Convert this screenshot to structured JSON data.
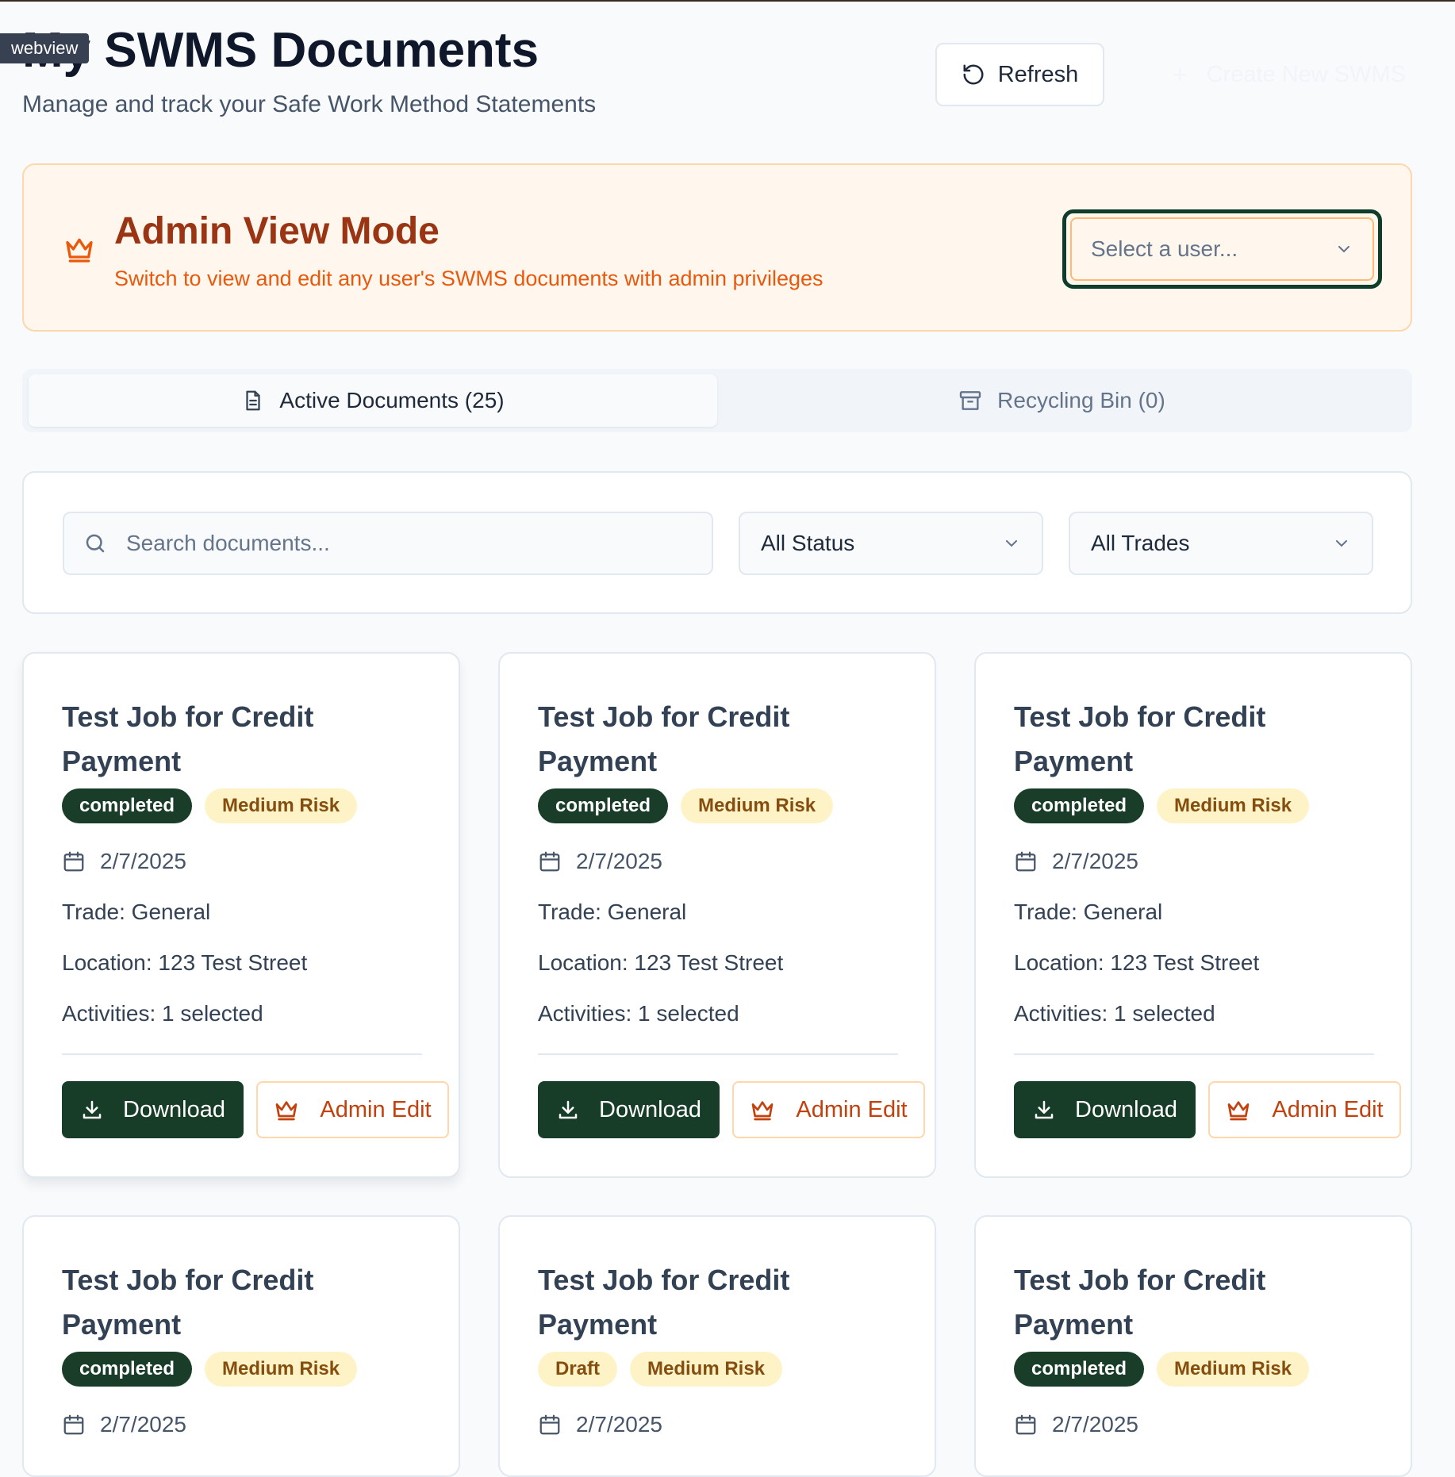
{
  "webview_tag": "webview",
  "header": {
    "title": "My SWMS Documents",
    "subtitle": "Manage and track your Safe Work Method Statements",
    "refresh_label": "Refresh",
    "create_label": "Create New SWMS"
  },
  "admin": {
    "title": "Admin View Mode",
    "description": "Switch to view and edit any user's SWMS documents with admin privileges",
    "user_select_placeholder": "Select a user..."
  },
  "tabs": [
    {
      "label": "Active Documents (25)",
      "active": true
    },
    {
      "label": "Recycling Bin (0)",
      "active": false
    }
  ],
  "filters": {
    "search_placeholder": "Search documents...",
    "status_value": "All Status",
    "trades_value": "All Trades"
  },
  "cards": [
    {
      "title": "Test Job for Credit Payment",
      "status": "completed",
      "risk": "Medium Risk",
      "date": "2/7/2025",
      "trade": "Trade: General",
      "location": "Location: 123 Test Street",
      "activities": "Activities: 1 selected",
      "download_label": "Download",
      "admin_edit_label": "Admin Edit"
    },
    {
      "title": "Test Job for Credit Payment",
      "status": "completed",
      "risk": "Medium Risk",
      "date": "2/7/2025",
      "trade": "Trade: General",
      "location": "Location: 123 Test Street",
      "activities": "Activities: 1 selected",
      "download_label": "Download",
      "admin_edit_label": "Admin Edit"
    },
    {
      "title": "Test Job for Credit Payment",
      "status": "completed",
      "risk": "Medium Risk",
      "date": "2/7/2025",
      "trade": "Trade: General",
      "location": "Location: 123 Test Street",
      "activities": "Activities: 1 selected",
      "download_label": "Download",
      "admin_edit_label": "Admin Edit"
    },
    {
      "title": "Test Job for Credit Payment",
      "status": "completed",
      "risk": "Medium Risk",
      "date": "2/7/2025"
    },
    {
      "title": "Test Job for Credit Payment",
      "status": "Draft",
      "risk": "Medium Risk",
      "date": "2/7/2025"
    },
    {
      "title": "Test Job for Credit Payment",
      "status": "completed",
      "risk": "Medium Risk",
      "date": "2/7/2025"
    }
  ],
  "colors": {
    "brand_green": "#173d29",
    "admin_orange": "#c2410c",
    "admin_bg": "#fff7ed",
    "risk_yellow_bg": "#fef3c7"
  },
  "icons": {
    "refresh": "refresh-icon",
    "create": "plus-icon",
    "admin": "crown-icon",
    "tab_active": "document-icon",
    "tab_bin": "archive-icon",
    "search": "search-icon",
    "date": "calendar-icon",
    "download": "download-icon",
    "admin_edit": "crown-icon",
    "delete": "trash-icon"
  }
}
